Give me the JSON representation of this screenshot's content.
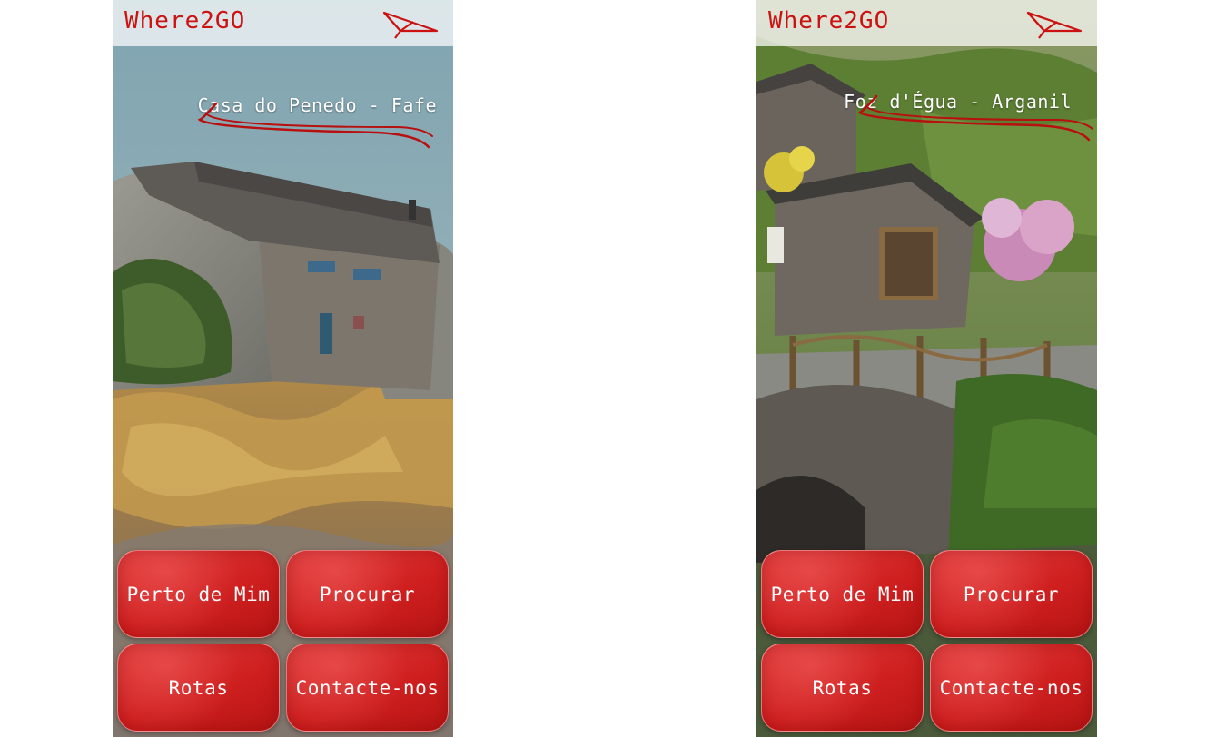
{
  "app": {
    "name": "Where2GO"
  },
  "screens": [
    {
      "place": "Casa do Penedo - Fafe",
      "buttons": [
        "Perto de Mim",
        "Procurar",
        "Rotas",
        "Contacte-nos"
      ]
    },
    {
      "place": "Foz d'Égua - Arganil",
      "buttons": [
        "Perto de Mim",
        "Procurar",
        "Rotas",
        "Contacte-nos"
      ]
    }
  ],
  "icons": {
    "logo_mark": "paper-plane-icon"
  },
  "colors": {
    "brand_red": "#cc1111",
    "button_red": "#d42222"
  }
}
